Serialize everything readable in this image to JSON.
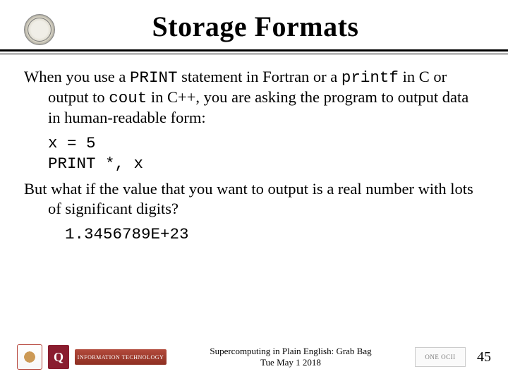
{
  "title": "Storage Formats",
  "body": {
    "p1_a": "When you use a ",
    "p1_code1": "PRINT",
    "p1_b": " statement in Fortran or a ",
    "p1_code2": "printf",
    "p1_c": " in C or output to ",
    "p1_code3": "cout",
    "p1_d": " in C++, you are asking the program to output data in human-readable form:",
    "codeline1": "x = 5",
    "codeline2": "PRINT *, x",
    "p2": "But what if the value that you want to output is a real number with lots of significant digits?",
    "codeline3": "1.3456789E+23"
  },
  "footer": {
    "line1": "Supercomputing in Plain English: Grab Bag",
    "line2": "Tue May 1 2018",
    "page": "45",
    "ou_letter": "Q",
    "it_label": "INFORMATION TECHNOLOGY",
    "onecii": "ONE OCII"
  }
}
